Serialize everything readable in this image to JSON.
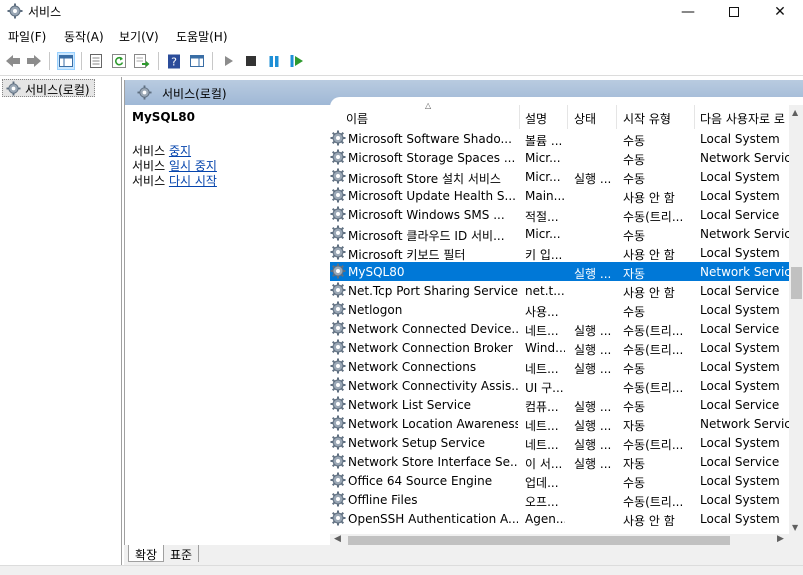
{
  "window": {
    "title": "서비스"
  },
  "menu": [
    "파일(F)",
    "동작(A)",
    "보기(V)",
    "도움말(H)"
  ],
  "tree": {
    "root_label": "서비스(로컬)"
  },
  "content_header": {
    "label": "서비스(로컬)"
  },
  "details": {
    "service_name": "MySQL80",
    "actions": [
      {
        "prefix": "서비스 ",
        "link": "중지"
      },
      {
        "prefix": "서비스 ",
        "link": "일시 중지"
      },
      {
        "prefix": "서비스 ",
        "link": "다시 시작"
      }
    ]
  },
  "columns": {
    "name": "이름",
    "description": "설명",
    "status": "상태",
    "startup": "시작 유형",
    "logon": "다음 사용자로 로"
  },
  "services": [
    {
      "name": "Microsoft Software Shado...",
      "description": "볼륨 ...",
      "status": "",
      "startup": "수동",
      "logon": "Local System"
    },
    {
      "name": "Microsoft Storage Spaces ...",
      "description": "Micr...",
      "status": "",
      "startup": "수동",
      "logon": "Network Service"
    },
    {
      "name": "Microsoft Store 설치 서비스",
      "description": "Micr...",
      "status": "실행 ...",
      "startup": "수동",
      "logon": "Local System"
    },
    {
      "name": "Microsoft Update Health S...",
      "description": "Main...",
      "status": "",
      "startup": "사용 안 함",
      "logon": "Local System"
    },
    {
      "name": "Microsoft Windows SMS ...",
      "description": "적절...",
      "status": "",
      "startup": "수동(트리...",
      "logon": "Local Service"
    },
    {
      "name": "Microsoft 클라우드 ID 서비...",
      "description": "Micr...",
      "status": "",
      "startup": "수동",
      "logon": "Network Service"
    },
    {
      "name": "Microsoft 키보드 필터",
      "description": "키 입...",
      "status": "",
      "startup": "사용 안 함",
      "logon": "Local System"
    },
    {
      "name": "MySQL80",
      "description": "",
      "status": "실행 ...",
      "startup": "자동",
      "logon": "Network Service"
    },
    {
      "name": "Net.Tcp Port Sharing Service",
      "description": "net.t...",
      "status": "",
      "startup": "사용 안 함",
      "logon": "Local Service"
    },
    {
      "name": "Netlogon",
      "description": "사용...",
      "status": "",
      "startup": "수동",
      "logon": "Local System"
    },
    {
      "name": "Network Connected Device...",
      "description": "네트...",
      "status": "실행 ...",
      "startup": "수동(트리...",
      "logon": "Local Service"
    },
    {
      "name": "Network Connection Broker",
      "description": "Wind...",
      "status": "실행 ...",
      "startup": "수동(트리...",
      "logon": "Local System"
    },
    {
      "name": "Network Connections",
      "description": "네트...",
      "status": "실행 ...",
      "startup": "수동",
      "logon": "Local System"
    },
    {
      "name": "Network Connectivity Assis...",
      "description": "UI 구...",
      "status": "",
      "startup": "수동(트리...",
      "logon": "Local System"
    },
    {
      "name": "Network List Service",
      "description": "컴퓨...",
      "status": "실행 ...",
      "startup": "수동",
      "logon": "Local Service"
    },
    {
      "name": "Network Location Awareness",
      "description": "네트...",
      "status": "실행 ...",
      "startup": "자동",
      "logon": "Network Service"
    },
    {
      "name": "Network Setup Service",
      "description": "네트...",
      "status": "실행 ...",
      "startup": "수동(트리...",
      "logon": "Local System"
    },
    {
      "name": "Network Store Interface Se...",
      "description": "이 서...",
      "status": "실행 ...",
      "startup": "자동",
      "logon": "Local Service"
    },
    {
      "name": "Office 64 Source Engine",
      "description": "업데...",
      "status": "",
      "startup": "수동",
      "logon": "Local System"
    },
    {
      "name": "Offline Files",
      "description": "오프...",
      "status": "",
      "startup": "수동(트리...",
      "logon": "Local System"
    },
    {
      "name": "OpenSSH Authentication A...",
      "description": "Agen...",
      "status": "",
      "startup": "사용 안 함",
      "logon": "Local System"
    }
  ],
  "selected_service": "MySQL80",
  "tabs": [
    "확장",
    "표준"
  ],
  "colors": {
    "selection": "#0078d7",
    "header_band": "#b9cbe0",
    "link": "#0645ad"
  }
}
